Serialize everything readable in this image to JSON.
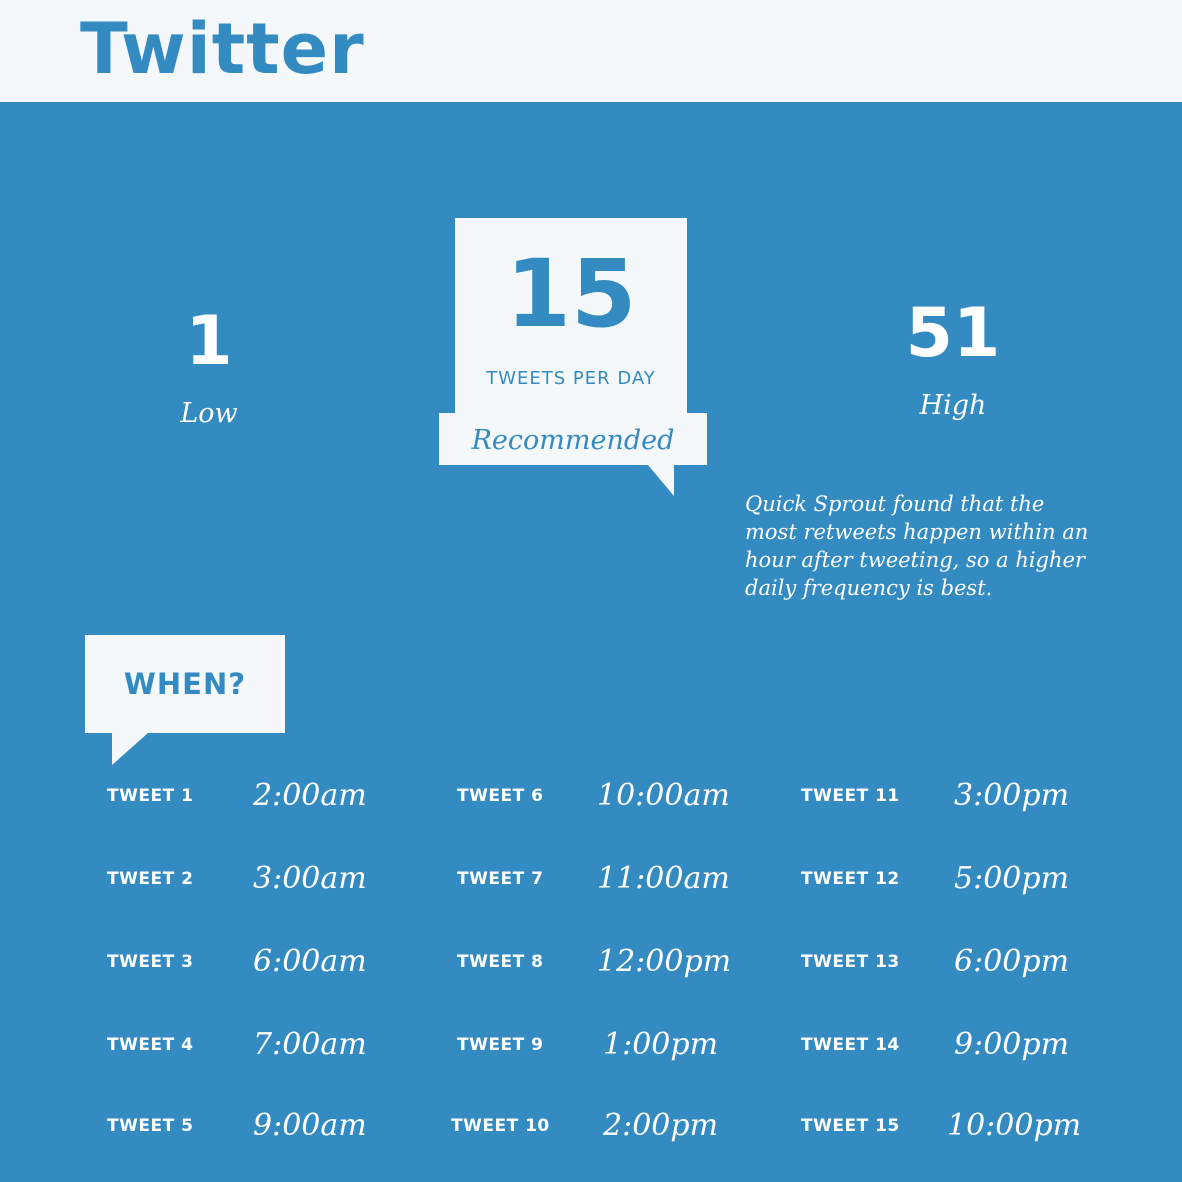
{
  "header": {
    "title": "Twitter"
  },
  "frequency": {
    "low": {
      "value": "1",
      "label": "Low"
    },
    "recommended": {
      "value": "15",
      "unit": "TWEETS PER DAY",
      "label": "Recommended"
    },
    "high": {
      "value": "51",
      "label": "High"
    }
  },
  "note": {
    "lines": [
      "Quick Sprout found that the",
      "most retweets happen within an",
      " hour after tweeting, so a higher",
      " daily frequency is best."
    ]
  },
  "when": {
    "label": "WHEN?"
  },
  "schedule": [
    {
      "label": "TWEET 1",
      "time": "2:00am"
    },
    {
      "label": "TWEET 2",
      "time": "3:00am"
    },
    {
      "label": "TWEET 3",
      "time": "6:00am"
    },
    {
      "label": "TWEET 4",
      "time": "7:00am"
    },
    {
      "label": "TWEET 5",
      "time": "9:00am"
    },
    {
      "label": "TWEET 6",
      "time": "10:00am"
    },
    {
      "label": "TWEET 7",
      "time": "11:00am"
    },
    {
      "label": "TWEET 8",
      "time": "12:00pm"
    },
    {
      "label": "TWEET 9",
      "time": "1:00pm"
    },
    {
      "label": "TWEET 10",
      "time": "2:00pm"
    },
    {
      "label": "TWEET 11",
      "time": "3:00pm"
    },
    {
      "label": "TWEET 12",
      "time": "5:00pm"
    },
    {
      "label": "TWEET 13",
      "time": "6:00pm"
    },
    {
      "label": "TWEET 14",
      "time": "9:00pm"
    },
    {
      "label": "TWEET 15",
      "time": "10:00pm"
    }
  ],
  "colors": {
    "background": "#348bc2",
    "panel": "#f4f8fa",
    "text": "#ffffff"
  }
}
